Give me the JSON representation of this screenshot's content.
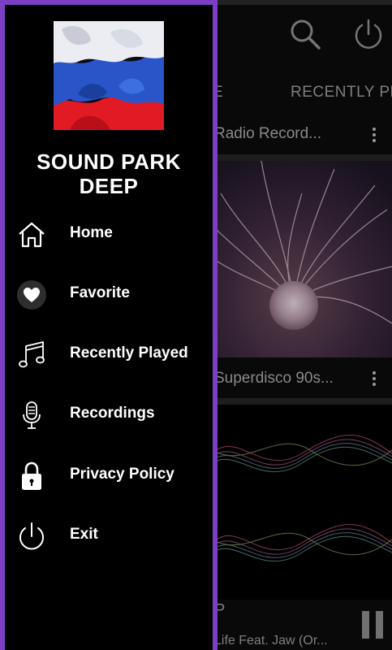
{
  "app": {
    "tabs": [
      {
        "label": "E"
      },
      {
        "label": "RECENTLY PL"
      }
    ],
    "cards": [
      {
        "title": "Radio Record..."
      },
      {
        "title": "Superdisco 90s..."
      },
      {
        "title": "P"
      },
      {
        "title": "Life Feat. Jaw (Or..."
      }
    ],
    "icons": {
      "search": "search-icon",
      "power": "power-icon",
      "pause": "pause-icon"
    }
  },
  "drawer": {
    "accent_color": "#7b3fc4",
    "station_name": "SOUND PARK\nDEEP",
    "menu": [
      {
        "label": "Home",
        "icon": "home-icon"
      },
      {
        "label": "Favorite",
        "icon": "heart-icon"
      },
      {
        "label": "Recently Played",
        "icon": "music-notes-icon"
      },
      {
        "label": "Recordings",
        "icon": "microphone-icon"
      },
      {
        "label": "Privacy Policy",
        "icon": "lock-icon"
      },
      {
        "label": "Exit",
        "icon": "power-icon"
      }
    ]
  }
}
